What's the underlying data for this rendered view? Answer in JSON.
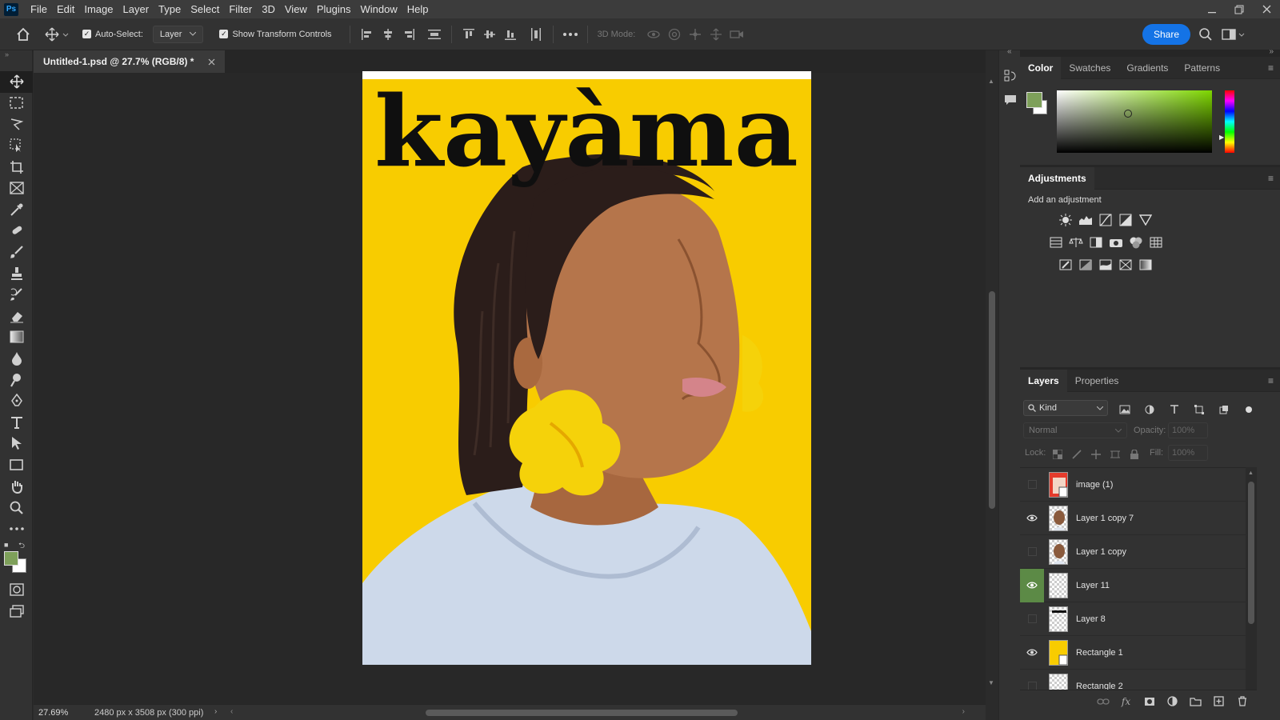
{
  "app": {
    "logo": "Ps"
  },
  "menu": [
    "File",
    "Edit",
    "Image",
    "Layer",
    "Type",
    "Select",
    "Filter",
    "3D",
    "View",
    "Plugins",
    "Window",
    "Help"
  ],
  "options": {
    "auto_select_label": "Auto-Select:",
    "auto_select_checked": true,
    "target_value": "Layer",
    "transform_label": "Show Transform Controls",
    "transform_checked": true,
    "mode_3d_label": "3D Mode:",
    "share_label": "Share"
  },
  "document": {
    "tab_title": "Untitled-1.psd @ 27.7% (RGB/8) *",
    "headline": "kayàma",
    "poster_color": "#f8cc00"
  },
  "status": {
    "zoom": "27.69%",
    "doc_size": "2480 px x 3508 px (300 ppi)"
  },
  "colors": {
    "foreground": "#7ea05a",
    "background": "#ffffff",
    "accent": "#1473e6"
  },
  "color_panel": {
    "tabs": [
      "Color",
      "Swatches",
      "Gradients",
      "Patterns"
    ],
    "active": "Color"
  },
  "adjustments": {
    "title": "Adjustments",
    "hint": "Add an adjustment"
  },
  "layers_panel": {
    "tabs": [
      "Layers",
      "Properties"
    ],
    "filter_label": "Kind",
    "blend_mode": "Normal",
    "opacity_label": "Opacity:",
    "opacity_value": "100%",
    "lock_label": "Lock:",
    "fill_label": "Fill:",
    "fill_value": "100%",
    "layers": [
      {
        "name": "image (1)",
        "visible": false
      },
      {
        "name": "Layer 1 copy 7",
        "visible": true
      },
      {
        "name": "Layer 1 copy",
        "visible": false
      },
      {
        "name": "Layer 11",
        "visible": true
      },
      {
        "name": "Layer 8",
        "visible": false
      },
      {
        "name": "Rectangle 1",
        "visible": true
      },
      {
        "name": "Rectangle 2",
        "visible": false
      }
    ]
  }
}
